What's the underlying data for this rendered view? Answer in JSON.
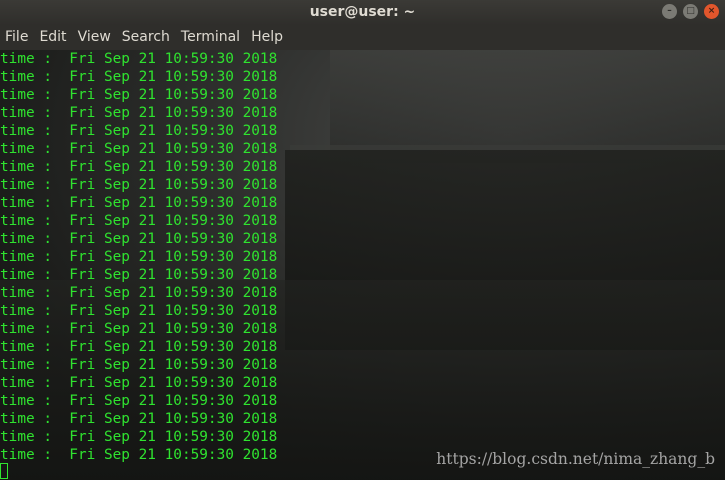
{
  "window": {
    "title": "user@user: ~",
    "controls": [
      {
        "name": "minimize",
        "glyph": "–"
      },
      {
        "name": "maximize",
        "glyph": "□"
      },
      {
        "name": "close",
        "glyph": "×"
      }
    ]
  },
  "menubar": {
    "items": [
      "File",
      "Edit",
      "View",
      "Search",
      "Terminal",
      "Help"
    ]
  },
  "terminal": {
    "text_color": "#2fe32f",
    "lines": [
      "time :  Fri Sep 21 10:59:30 2018",
      "time :  Fri Sep 21 10:59:30 2018",
      "time :  Fri Sep 21 10:59:30 2018",
      "time :  Fri Sep 21 10:59:30 2018",
      "time :  Fri Sep 21 10:59:30 2018",
      "time :  Fri Sep 21 10:59:30 2018",
      "time :  Fri Sep 21 10:59:30 2018",
      "time :  Fri Sep 21 10:59:30 2018",
      "time :  Fri Sep 21 10:59:30 2018",
      "time :  Fri Sep 21 10:59:30 2018",
      "time :  Fri Sep 21 10:59:30 2018",
      "time :  Fri Sep 21 10:59:30 2018",
      "time :  Fri Sep 21 10:59:30 2018",
      "time :  Fri Sep 21 10:59:30 2018",
      "time :  Fri Sep 21 10:59:30 2018",
      "time :  Fri Sep 21 10:59:30 2018",
      "time :  Fri Sep 21 10:59:30 2018",
      "time :  Fri Sep 21 10:59:30 2018",
      "time :  Fri Sep 21 10:59:30 2018",
      "time :  Fri Sep 21 10:59:30 2018",
      "time :  Fri Sep 21 10:59:30 2018",
      "time :  Fri Sep 21 10:59:30 2018",
      "time :  Fri Sep 21 10:59:30 2018"
    ]
  },
  "watermark": "https://blog.csdn.net/nima_zhang_b"
}
